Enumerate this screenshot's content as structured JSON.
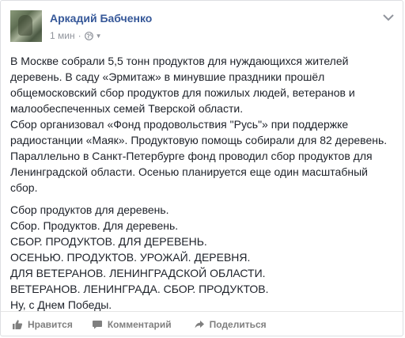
{
  "post": {
    "author": "Аркадий Бабченко",
    "time": "1 мин",
    "separator": "·",
    "privacy_icon": "globe-icon",
    "paragraphs": [
      {
        "lines": [
          "В Москве собрали 5,5 тонн продуктов для нуждающихся жителей",
          "деревень. В саду «Эрмитаж» в минувшие праздники прошёл",
          "общемосковский сбор продуктов для пожилых людей, ветеранов и",
          "малообеспеченных семей Тверской области.",
          "Сбор организовал «Фонд продовольствия \"Русь\"» при поддержке",
          "радиостанции «Маяк». Продуктовую помощь собирали для 82 деревень.",
          "Параллельно в Санкт-Петербурге фонд проводил сбор продуктов для",
          "Ленинградской области. Осенью планируется еще один масштабный",
          "сбор."
        ]
      },
      {
        "lines": [
          "Сбор продуктов для деревень.",
          "Сбор. Продуктов. Для деревень.",
          "СБОР. ПРОДУКТОВ. ДЛЯ ДЕРЕВЕНЬ.",
          "ОСЕНЬЮ. ПРОДУКТОВ. УРОЖАЙ. ДЕРЕВНЯ.",
          "ДЛЯ ВЕТЕРАНОВ. ЛЕНИНГРАДСКОЙ ОБЛАСТИ.",
          "ВЕТЕРАНОВ. ЛЕНИНГРАДА. СБОР. ПРОДУКТОВ.",
          "Ну, с Днем Победы."
        ]
      }
    ]
  },
  "actions": {
    "like": "Нравится",
    "comment": "Комментарий",
    "share": "Поделиться"
  }
}
